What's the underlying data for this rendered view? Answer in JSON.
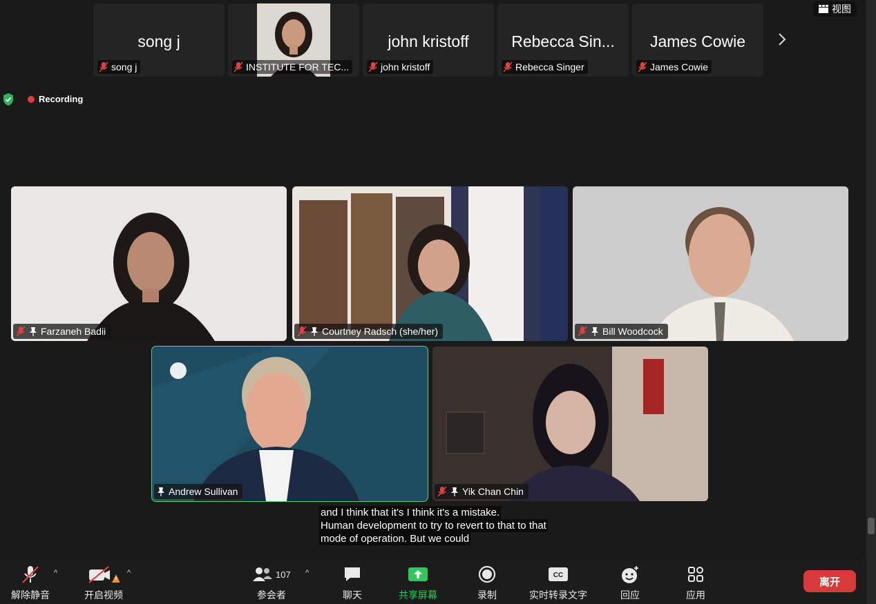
{
  "view_button": {
    "label": "视图"
  },
  "strip": [
    {
      "big_name": "song j",
      "tag": "song j"
    },
    {
      "big_name": "",
      "tag": "INSTITUTE FOR TEC..."
    },
    {
      "big_name": "john kristoff",
      "tag": "john kristoff"
    },
    {
      "big_name": "Rebecca Sin...",
      "tag": "Rebecca Singer"
    },
    {
      "big_name": "James Cowie",
      "tag": "James Cowie"
    }
  ],
  "recording": {
    "label": "Recording"
  },
  "tiles": [
    {
      "name": "Farzaneh Badii"
    },
    {
      "name": "Courtney Radsch (she/her)"
    },
    {
      "name": "Bill Woodcock"
    },
    {
      "name": "Andrew Sullivan"
    },
    {
      "name": "Yik Chan Chin"
    }
  ],
  "caption": {
    "lines": [
      "and I think that it's I think it's a mistake.",
      "Human development to try to revert to that to that",
      "mode of operation. But we could"
    ]
  },
  "toolbar": {
    "unmute": "解除静音",
    "start_video": "开启视频",
    "participants": "参会者",
    "participants_count": "107",
    "chat": "聊天",
    "share_screen": "共享屏幕",
    "record": "录制",
    "live_transcript": "实时转录文字",
    "reactions": "回应",
    "apps": "应用",
    "leave": "离开"
  },
  "colors": {
    "active_speaker": "#5bd26b",
    "leave": "#d63a3a",
    "share": "#31c75c",
    "recording": "#e23b3b"
  }
}
